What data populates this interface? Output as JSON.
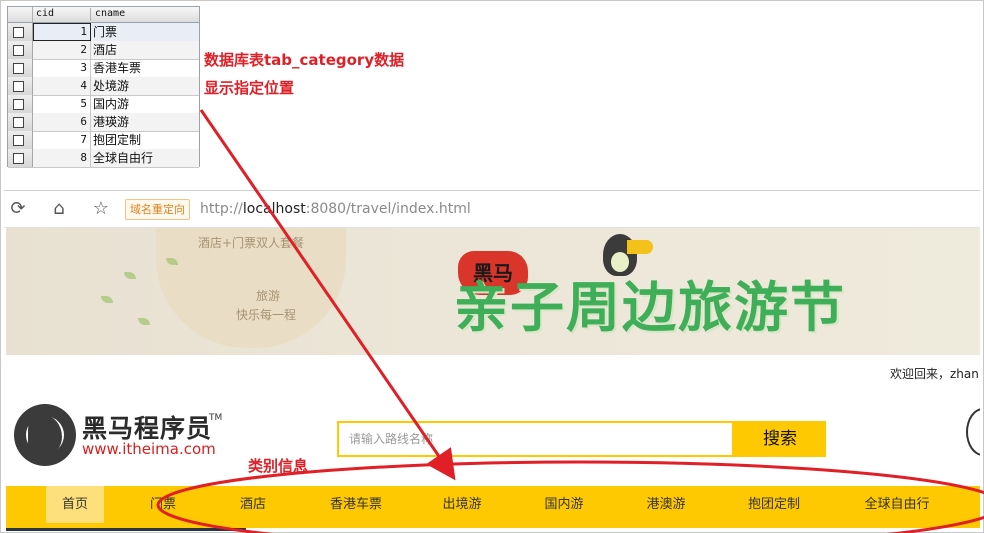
{
  "db_table": {
    "columns": [
      "cid",
      "cname"
    ],
    "rows": [
      {
        "cid": "1",
        "cname": "门票"
      },
      {
        "cid": "2",
        "cname": "酒店"
      },
      {
        "cid": "3",
        "cname": "香港车票"
      },
      {
        "cid": "4",
        "cname": "处境游"
      },
      {
        "cid": "5",
        "cname": "国内游"
      },
      {
        "cid": "6",
        "cname": "港瑛游"
      },
      {
        "cid": "7",
        "cname": "抱团定制"
      },
      {
        "cid": "8",
        "cname": "全球自由行"
      }
    ]
  },
  "annotations": {
    "line1": "数据库表tab_category数据",
    "line2": "显示指定位置",
    "category_label": "类别信息",
    "color": "#e01f26"
  },
  "browser": {
    "redirect_badge": "域名重定向",
    "url_scheme": "http://",
    "url_host": "localhost",
    "url_rest": ":8080/travel/index.html"
  },
  "banner": {
    "sack_line1": "酒店+门票双人套餐",
    "sack_line2": "旅游",
    "sack_line3": "快乐每一程",
    "brand": "黑马",
    "festival_title": "亲子周边旅游节"
  },
  "header": {
    "welcome": "欢迎回来，zhan",
    "logo_text": "黑马程序员",
    "logo_tm": "TM",
    "logo_url": "www.itheima.com",
    "search_placeholder": "请输入路线名称",
    "search_button": "搜索"
  },
  "nav": {
    "items": [
      "首页",
      "门票",
      "酒店",
      "香港车票",
      "出境游",
      "国内游",
      "港澳游",
      "抱团定制",
      "全球自由行"
    ],
    "active_index": 0,
    "accent": "#ffc900"
  }
}
